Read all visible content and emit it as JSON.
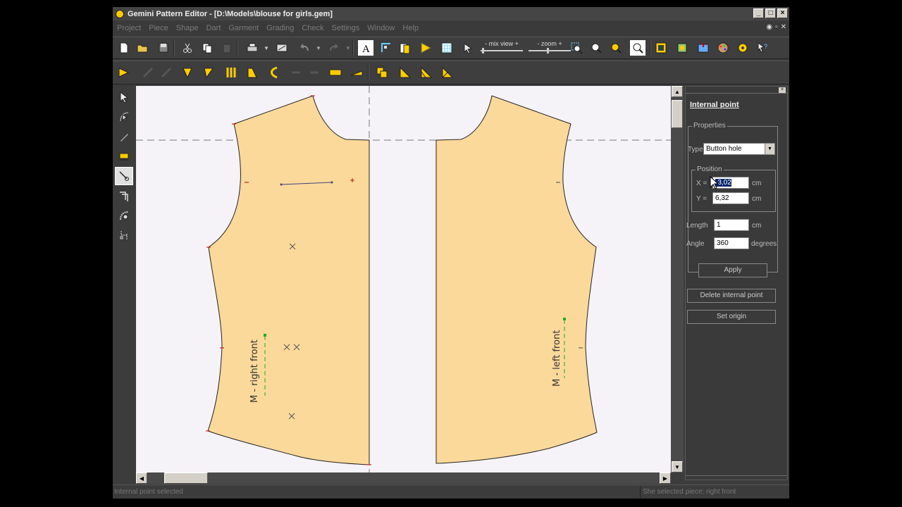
{
  "window": {
    "title": "Gemini Pattern Editor - [D:\\Models\\blouse for girls.gem]"
  },
  "menu": [
    "Project",
    "Piece",
    "Shape",
    "Dart",
    "Garment",
    "Grading",
    "Check",
    "Settings",
    "Window",
    "Help"
  ],
  "toolbar": {
    "mix_view_label": "- mix view +",
    "zoom_label": "- zoom +"
  },
  "canvas": {
    "piece_right_label": "M - right front",
    "piece_left_label": "M - left front",
    "piece_fill": "#fbd99a"
  },
  "panel": {
    "title": "Internal point",
    "properties_legend": "Properties",
    "type_label": "Type",
    "type_value": "Button hole",
    "position_legend": "Position",
    "x_label": "X =",
    "x_value": "-3,02",
    "x_unit": "cm",
    "y_label": "Y =",
    "y_value": "6,32",
    "y_unit": "cm",
    "length_label": "Length",
    "length_value": "1",
    "length_unit": "cm",
    "angle_label": "Angle",
    "angle_value": "360",
    "angle_unit": "degrees",
    "apply_label": "Apply",
    "delete_label": "Delete internal point",
    "set_origin_label": "Set origin"
  },
  "status": {
    "left": "Internal point selected",
    "right": "She selected piece: right front"
  },
  "colors": {
    "accent": "#ffcc00",
    "background": "#3c3c3c"
  }
}
